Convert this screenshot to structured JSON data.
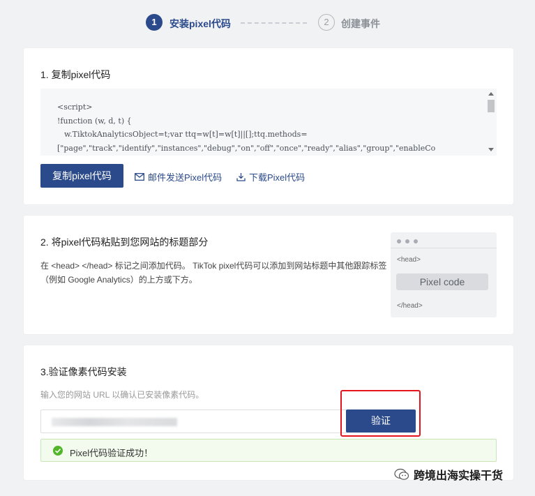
{
  "stepper": {
    "step1": {
      "number": "1",
      "label": "安装pixel代码"
    },
    "step2": {
      "number": "2",
      "label": "创建事件"
    }
  },
  "section1": {
    "title": "1. 复制pixel代码",
    "code_lines": [
      "<script>",
      "!function (w, d, t) {",
      "w.TiktokAnalyticsObject=t;var ttq=w[t]=w[t]||[];ttq.methods=",
      "[\"page\",\"track\",\"identify\",\"instances\",\"debug\",\"on\",\"off\",\"once\",\"ready\",\"alias\",\"group\",\"enableCo"
    ],
    "copy_button": "复制pixel代码",
    "email_link": "邮件发送Pixel代码",
    "download_link": "下载Pixel代码"
  },
  "section2": {
    "title": "2. 将pixel代码粘贴到您网站的标题部分",
    "description": "在 <head> </head> 标记之间添加代码。 TikTok pixel代码可以添加到网站标题中其他跟踪标签（例如 Google Analytics）的上方或下方。",
    "preview": {
      "head_open": "<head>",
      "pixel_code": "Pixel code",
      "head_close": "</head>"
    }
  },
  "section3": {
    "title": "3.验证像素代码安装",
    "hint": "输入您的网站 URL 以确认已安装像素代码。",
    "url_value": "",
    "verify_button": "验证",
    "success_message": "Pixel代码验证成功！"
  },
  "watermark": {
    "text": "跨境出海实操干货"
  },
  "colors": {
    "primary": "#2b4a8b",
    "highlight": "#e4141c",
    "success": "#52b52a"
  }
}
